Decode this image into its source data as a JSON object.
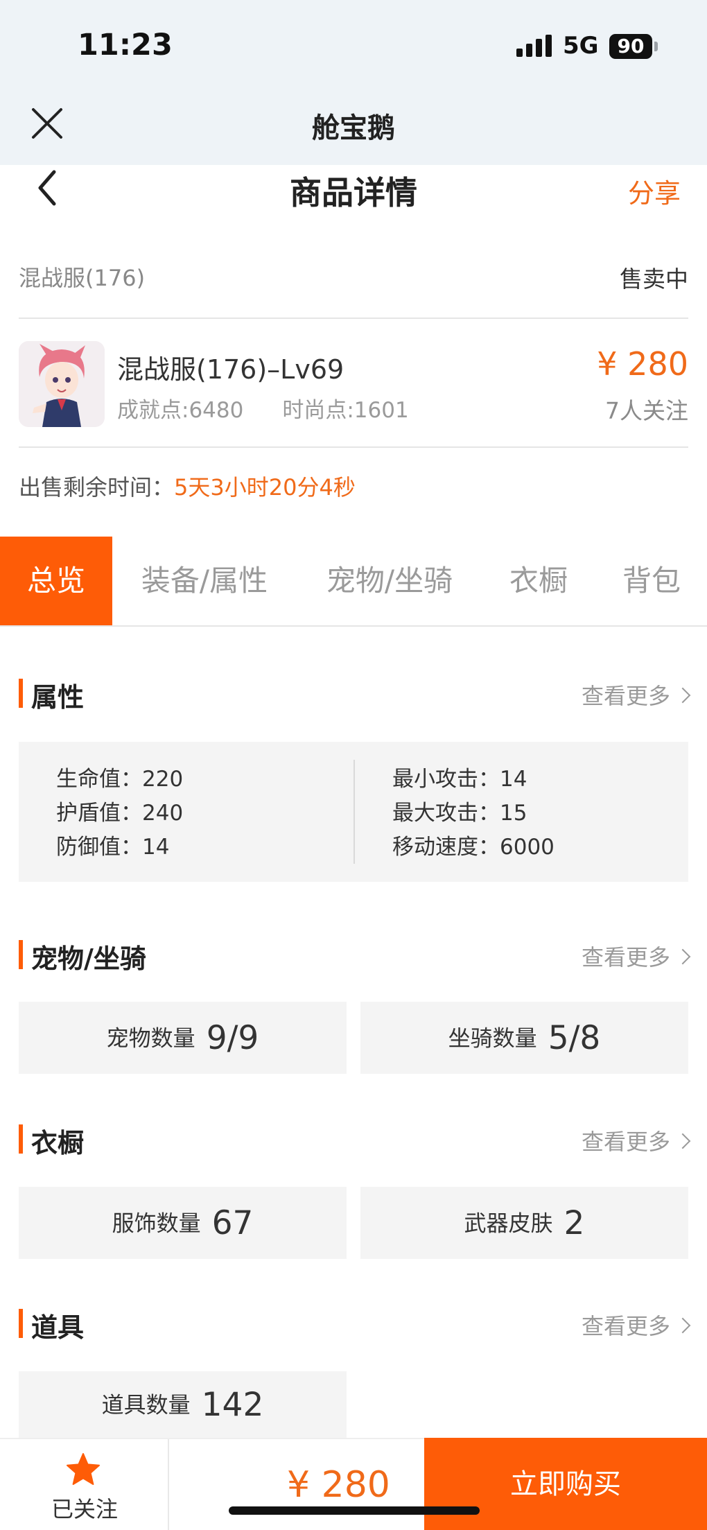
{
  "status_bar": {
    "time": "11:23",
    "network": "5G",
    "battery": "90"
  },
  "mini_header": {
    "title": "舱宝鹅"
  },
  "nav": {
    "title": "商品详情",
    "share_label": "分享"
  },
  "server": {
    "name": "混战服(176)",
    "status": "售卖中"
  },
  "product": {
    "title": "混战服(176)–Lv69",
    "achievement": "成就点:6480",
    "fashion": "时尚点:1601",
    "price": "¥ 280",
    "followers": "7人关注"
  },
  "remaining": {
    "label": "出售剩余时间：",
    "value": "5天3小时20分4秒"
  },
  "tabs": [
    {
      "label": "总览",
      "active": true
    },
    {
      "label": "装备/属性"
    },
    {
      "label": "宠物/坐骑"
    },
    {
      "label": "衣橱"
    },
    {
      "label": "背包"
    }
  ],
  "sections": {
    "attributes": {
      "title": "属性",
      "more": "查看更多",
      "left": [
        "生命值：220",
        "护盾值：240",
        "防御值：14"
      ],
      "right": [
        "最小攻击：14",
        "最大攻击：15",
        "移动速度：6000"
      ]
    },
    "pets": {
      "title": "宠物/坐骑",
      "more": "查看更多",
      "cards": [
        {
          "label": "宠物数量",
          "value": "9/9"
        },
        {
          "label": "坐骑数量",
          "value": "5/8"
        }
      ]
    },
    "wardrobe": {
      "title": "衣橱",
      "more": "查看更多",
      "cards": [
        {
          "label": "服饰数量",
          "value": "67"
        },
        {
          "label": "武器皮肤",
          "value": "2"
        }
      ]
    },
    "items": {
      "title": "道具",
      "more": "查看更多",
      "cards": [
        {
          "label": "道具数量",
          "value": "142"
        }
      ]
    }
  },
  "bottom_bar": {
    "fav_label": "已关注",
    "price": "¥ 280",
    "buy_label": "立即购买"
  },
  "colors": {
    "accent": "#fe5c07",
    "price": "#f06a19"
  },
  "icons": [
    "close-icon",
    "back-arrow-icon",
    "chevron-right-icon",
    "star-icon",
    "signal-icon",
    "battery-icon"
  ]
}
